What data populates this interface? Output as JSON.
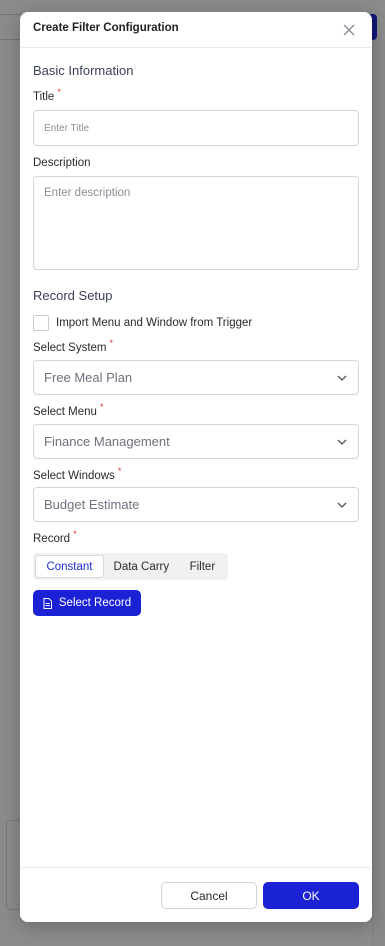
{
  "modal": {
    "title": "Create Filter Configuration",
    "basic_section": "Basic Information",
    "title_label": "Title",
    "title_placeholder": "Enter Title",
    "description_label": "Description",
    "description_placeholder": "Enter description",
    "record_section": "Record Setup",
    "import_checkbox_label": "Import Menu and Window from Trigger",
    "import_checked": false,
    "system_label": "Select System",
    "system_value": "Free Meal Plan",
    "menu_label": "Select Menu",
    "menu_value": "Finance Management",
    "windows_label": "Select Windows",
    "windows_value": "Budget Estimate",
    "record_label": "Record",
    "record_tabs": [
      "Constant",
      "Data Carry",
      "Filter"
    ],
    "record_tab_active": "Constant",
    "select_record_button": "Select Record",
    "cancel_button": "Cancel",
    "ok_button": "OK",
    "required_marker": "*"
  },
  "colors": {
    "accent": "#1b22d6",
    "required": "#e0342a",
    "overlay": "#8f8f8f"
  },
  "icons": {
    "close": "close-icon",
    "chevron": "chevron-down-icon",
    "document": "document-icon"
  }
}
